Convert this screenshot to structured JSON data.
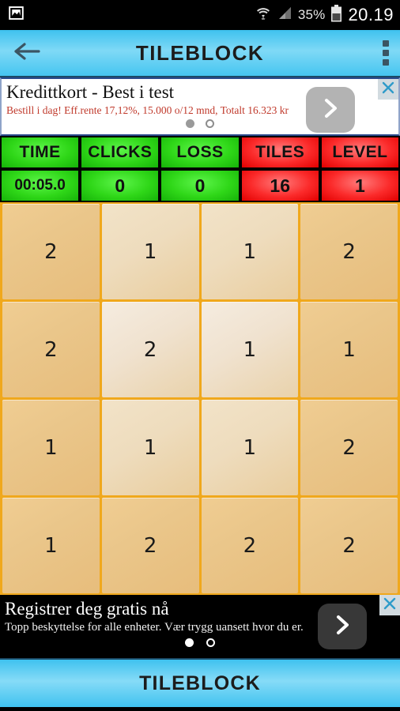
{
  "statusbar": {
    "left_icon": "screenshot-image-icon",
    "wifi_icon": "wifi-icon",
    "signal_icon": "cell-signal-icon",
    "battery_percent": "35%",
    "battery_icon": "battery-icon",
    "clock": "20.19"
  },
  "actionbar": {
    "back_icon": "back-arrow-icon",
    "title": "TILEBLOCK",
    "menu_icon": "overflow-menu-icon"
  },
  "ad_top": {
    "title": "Kredittkort - Best i test",
    "subtitle": "Bestill i dag! Eff.rente 17,12%, 15.000 o/12 mnd, Totalt 16.323 kr",
    "cta_icon": "chevron-right-icon",
    "close_icon": "close-x-icon",
    "dots": [
      "filled",
      "empty"
    ]
  },
  "stats": {
    "headers": [
      "TIME",
      "CLICKS",
      "LOSS",
      "TILES",
      "LEVEL"
    ],
    "values": [
      "00:05.0",
      "0",
      "0",
      "16",
      "1"
    ],
    "header_colors": [
      "green",
      "green",
      "green",
      "red",
      "red"
    ],
    "value_colors": [
      "green",
      "green",
      "green",
      "red",
      "red"
    ]
  },
  "grid": {
    "rows": [
      [
        "2",
        "1",
        "1",
        "2"
      ],
      [
        "2",
        "2",
        "1",
        "1"
      ],
      [
        "1",
        "1",
        "1",
        "2"
      ],
      [
        "1",
        "2",
        "2",
        "2"
      ]
    ]
  },
  "ad_bottom": {
    "title": "Registrer deg gratis nå",
    "subtitle": "Topp beskyttelse for alle enheter. Vær trygg uansett hvor du er.",
    "cta_icon": "chevron-right-icon",
    "close_icon": "close-x-icon",
    "dots": [
      "filled",
      "empty"
    ]
  },
  "bottombar": {
    "label": "TILEBLOCK"
  },
  "colors": {
    "accent_blue": "#3fc2ef",
    "grid_orange": "#f0a81c",
    "tile_tan": "#e7bd7c",
    "stat_green": "#2fd718",
    "stat_red": "#fb2a2a"
  }
}
